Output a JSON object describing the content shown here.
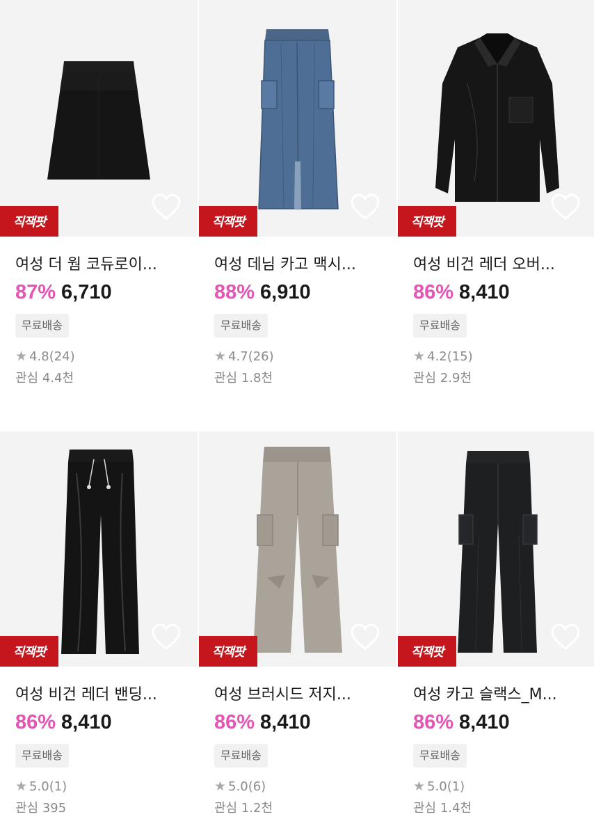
{
  "badge_label": "직잭팟",
  "products": [
    {
      "title": "여성 더 웜 코듀로이...",
      "discount": "87%",
      "price": "6,710",
      "shipping": "무료배송",
      "rating": "4.8",
      "reviews": "(24)",
      "likes": "관심 4.4천",
      "image": "black-mini-skirt"
    },
    {
      "title": "여성 데님 카고 맥시...",
      "discount": "88%",
      "price": "6,910",
      "shipping": "무료배송",
      "rating": "4.7",
      "reviews": "(26)",
      "likes": "관심 1.8천",
      "image": "denim-cargo-maxi-skirt"
    },
    {
      "title": "여성 비건 레더 오버...",
      "discount": "86%",
      "price": "8,410",
      "shipping": "무료배송",
      "rating": "4.2",
      "reviews": "(15)",
      "likes": "관심 2.9천",
      "image": "black-leather-shirt"
    },
    {
      "title": "여성 비건 레더 밴딩...",
      "discount": "86%",
      "price": "8,410",
      "shipping": "무료배송",
      "rating": "5.0",
      "reviews": "(1)",
      "likes": "관심 395",
      "image": "black-leather-pants"
    },
    {
      "title": "여성 브러시드 저지...",
      "discount": "86%",
      "price": "8,410",
      "shipping": "무료배송",
      "rating": "5.0",
      "reviews": "(6)",
      "likes": "관심 1.2천",
      "image": "grey-cargo-pants"
    },
    {
      "title": "여성 카고 슬랙스_M...",
      "discount": "86%",
      "price": "8,410",
      "shipping": "무료배송",
      "rating": "5.0",
      "reviews": "(1)",
      "likes": "관심 1.4천",
      "image": "black-cargo-slacks"
    }
  ],
  "colors": {
    "discount": "#e455b5",
    "badge": "#c4161c",
    "thumb_bg": "#f3f3f3"
  }
}
